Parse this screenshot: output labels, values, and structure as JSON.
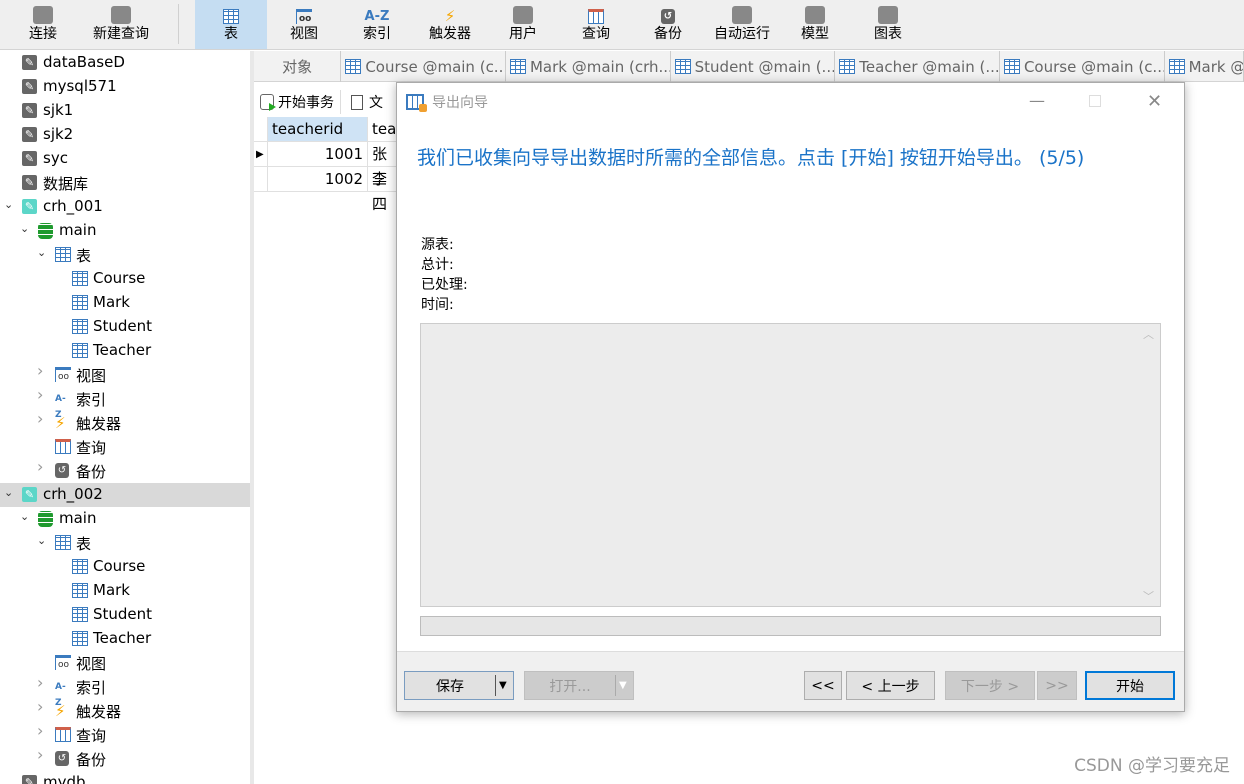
{
  "toolbar": {
    "items": [
      {
        "label": "连接",
        "icon": "plug-icon"
      },
      {
        "label": "新建查询",
        "icon": "new-query-icon"
      },
      {
        "label": "表",
        "icon": "table-icon",
        "active": true
      },
      {
        "label": "视图",
        "icon": "view-icon"
      },
      {
        "label": "索引",
        "icon": "index-icon",
        "glyph": "A-Z"
      },
      {
        "label": "触发器",
        "icon": "trigger-icon"
      },
      {
        "label": "用户",
        "icon": "user-icon"
      },
      {
        "label": "查询",
        "icon": "query-icon"
      },
      {
        "label": "备份",
        "icon": "backup-icon"
      },
      {
        "label": "自动运行",
        "icon": "schedule-icon"
      },
      {
        "label": "模型",
        "icon": "model-icon"
      },
      {
        "label": "图表",
        "icon": "chart-icon"
      }
    ]
  },
  "tree": [
    {
      "label": "dataBaseD",
      "level": 0,
      "icon": "sqlite-icon"
    },
    {
      "label": "mysql571",
      "level": 0,
      "icon": "sqlite-icon"
    },
    {
      "label": "sjk1",
      "level": 0,
      "icon": "sqlite-icon"
    },
    {
      "label": "sjk2",
      "level": 0,
      "icon": "sqlite-icon"
    },
    {
      "label": "syc",
      "level": 0,
      "icon": "sqlite-icon"
    },
    {
      "label": "数据库",
      "level": 0,
      "icon": "sqlite-icon"
    },
    {
      "label": "crh_001",
      "level": 0,
      "icon": "connection-icon",
      "chev": "open"
    },
    {
      "label": "main",
      "level": 1,
      "icon": "database-icon",
      "chev": "open"
    },
    {
      "label": "表",
      "level": 2,
      "icon": "table-icon",
      "chev": "open"
    },
    {
      "label": "Course",
      "level": 3,
      "icon": "table-icon"
    },
    {
      "label": "Mark",
      "level": 3,
      "icon": "table-icon"
    },
    {
      "label": "Student",
      "level": 3,
      "icon": "table-icon"
    },
    {
      "label": "Teacher",
      "level": 3,
      "icon": "table-icon"
    },
    {
      "label": "视图",
      "level": 2,
      "icon": "view-icon",
      "chev": "closed"
    },
    {
      "label": "索引",
      "level": 2,
      "icon": "index-icon",
      "chev": "closed"
    },
    {
      "label": "触发器",
      "level": 2,
      "icon": "trigger-icon",
      "chev": "closed"
    },
    {
      "label": "查询",
      "level": 2,
      "icon": "query-icon"
    },
    {
      "label": "备份",
      "level": 2,
      "icon": "backup-icon",
      "chev": "closed"
    },
    {
      "label": "crh_002",
      "level": 0,
      "icon": "connection-icon",
      "chev": "open",
      "selected": true
    },
    {
      "label": "main",
      "level": 1,
      "icon": "database-icon",
      "chev": "open"
    },
    {
      "label": "表",
      "level": 2,
      "icon": "table-icon",
      "chev": "open"
    },
    {
      "label": "Course",
      "level": 3,
      "icon": "table-icon"
    },
    {
      "label": "Mark",
      "level": 3,
      "icon": "table-icon"
    },
    {
      "label": "Student",
      "level": 3,
      "icon": "table-icon"
    },
    {
      "label": "Teacher",
      "level": 3,
      "icon": "table-icon"
    },
    {
      "label": "视图",
      "level": 2,
      "icon": "view-icon"
    },
    {
      "label": "索引",
      "level": 2,
      "icon": "index-icon",
      "chev": "closed"
    },
    {
      "label": "触发器",
      "level": 2,
      "icon": "trigger-icon",
      "chev": "closed"
    },
    {
      "label": "查询",
      "level": 2,
      "icon": "query-icon",
      "chev": "closed"
    },
    {
      "label": "备份",
      "level": 2,
      "icon": "backup-icon",
      "chev": "closed"
    },
    {
      "label": "mydb",
      "level": 0,
      "icon": "sqlite-icon"
    }
  ],
  "tabs": {
    "objects": "对象",
    "items": [
      "Course @main (c...",
      "Mark @main (crh...",
      "Student @main (...",
      "Teacher @main (...",
      "Course @main (c...",
      "Mark @"
    ]
  },
  "subbar": {
    "begin_transaction": "开始事务",
    "text": "文"
  },
  "grid": {
    "columns": [
      "teacherid",
      "teac"
    ],
    "rows": [
      [
        "1001",
        "张三"
      ],
      [
        "1002",
        "李四"
      ]
    ]
  },
  "dialog": {
    "title": "导出向导",
    "heading": "我们已收集向导导出数据时所需的全部信息。点击 [开始] 按钮开始导出。 (5/5)",
    "info": [
      "源表:",
      "总计:",
      "已处理:",
      "时间:"
    ],
    "progress": 0,
    "buttons": {
      "save": "保存",
      "open": "打开...",
      "first": "<<",
      "prev": "< 上一步",
      "next": "下一步 >",
      "last": ">>",
      "start": "开始"
    }
  },
  "watermark": "CSDN @学习要充足"
}
